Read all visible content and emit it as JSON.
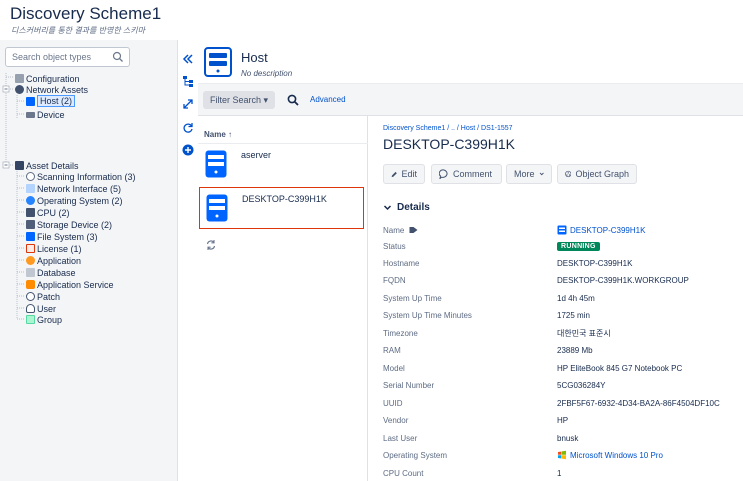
{
  "page": {
    "title": "Discovery Scheme1",
    "subtitle": "디스커버리를 통한 결과를 반영한 스키마"
  },
  "sidebar": {
    "search_placeholder": "Search object types",
    "tree": [
      {
        "label": "Configuration",
        "icon": "configuration-icon"
      },
      {
        "label": "Network Assets",
        "icon": "network-assets-icon"
      },
      {
        "label": "Host (2)",
        "icon": "host-icon",
        "selected": true
      },
      {
        "label": "Device",
        "icon": "device-icon"
      },
      {
        "label": "Asset Details",
        "icon": "asset-details-icon"
      },
      {
        "label": "Scanning Information (3)",
        "icon": "scanning-icon"
      },
      {
        "label": "Network Interface (5)",
        "icon": "network-interface-icon"
      },
      {
        "label": "Operating System (2)",
        "icon": "operating-system-icon"
      },
      {
        "label": "CPU (2)",
        "icon": "cpu-icon"
      },
      {
        "label": "Storage Device (2)",
        "icon": "storage-icon"
      },
      {
        "label": "File System (3)",
        "icon": "file-system-icon"
      },
      {
        "label": "License (1)",
        "icon": "license-icon"
      },
      {
        "label": "Application",
        "icon": "application-icon"
      },
      {
        "label": "Database",
        "icon": "database-icon"
      },
      {
        "label": "Application Service",
        "icon": "application-service-icon"
      },
      {
        "label": "Patch",
        "icon": "patch-icon"
      },
      {
        "label": "User",
        "icon": "user-icon"
      },
      {
        "label": "Group",
        "icon": "group-icon"
      }
    ]
  },
  "object_type": {
    "title": "Host",
    "description": "No description"
  },
  "filter_bar": {
    "filter_label": "Filter Search ▾",
    "advanced_label": "Advanced"
  },
  "list": {
    "header": "Name ↑",
    "items": [
      {
        "name": "aserver"
      },
      {
        "name": "DESKTOP-C399H1K",
        "selected": true
      }
    ]
  },
  "detail": {
    "breadcrumb": "Discovery Scheme1 / .. / Host / DS1-1557",
    "title": "DESKTOP-C399H1K",
    "actions": {
      "edit": "Edit",
      "comment": "Comment",
      "more": "More",
      "object_graph": "Object Graph"
    },
    "section_title": "Details",
    "attributes": [
      {
        "key": "Name",
        "value": "DESKTOP-C399H1K",
        "link": true
      },
      {
        "key": "Status",
        "value": "RUNNING",
        "badge": true
      },
      {
        "key": "Hostname",
        "value": "DESKTOP-C399H1K"
      },
      {
        "key": "FQDN",
        "value": "DESKTOP-C399H1K.WORKGROUP"
      },
      {
        "key": "System Up Time",
        "value": "1d 4h 45m"
      },
      {
        "key": "System Up Time Minutes",
        "value": "1725 min"
      },
      {
        "key": "Timezone",
        "value": "대한민국 표준시"
      },
      {
        "key": "RAM",
        "value": "23889 Mb"
      },
      {
        "key": "Model",
        "value": "HP EliteBook 845 G7 Notebook PC"
      },
      {
        "key": "Serial Number",
        "value": "5CG036284Y"
      },
      {
        "key": "UUID",
        "value": "2FBF5F67-6932-4D34-BA2A-86F4504DF10C"
      },
      {
        "key": "Vendor",
        "value": "HP"
      },
      {
        "key": "Last User",
        "value": "bnusk"
      },
      {
        "key": "Operating System",
        "value": "Microsoft Windows 10 Pro",
        "link": true
      },
      {
        "key": "CPU Count",
        "value": "1"
      }
    ]
  },
  "colors": {
    "accent": "#0052cc",
    "status_running": "#00875a",
    "selected_outline": "#de350b",
    "host_icon": "#0065ff"
  }
}
